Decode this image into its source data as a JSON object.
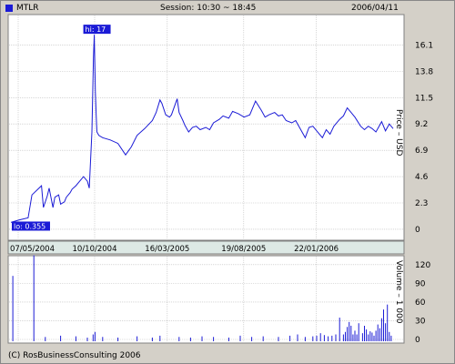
{
  "header": {
    "ticker": "MTLR",
    "session": "Session: 10:30 ~ 18:45",
    "date": "2006/04/11"
  },
  "footer": {
    "copyright": "(C) RosBusinessConsulting 2006"
  },
  "colors": {
    "frame_bg": "#d4d0c8",
    "plot_bg": "#ffffff",
    "line": "#1b1bd6",
    "bars": "#1b1bd6",
    "grid": "#bdbdbd",
    "date_bar": "#dde9e5",
    "marker_bg": "#1b1bd6",
    "marker_text": "#ffffff"
  },
  "chart_data": [
    {
      "type": "line",
      "title": "",
      "ylabel": "Price – USD",
      "xlabel": "",
      "yticks": [
        "0",
        "2.3",
        "4.6",
        "6.9",
        "9.2",
        "11.5",
        "13.8",
        "16.1"
      ],
      "ytick_values": [
        0,
        2.3,
        4.6,
        6.9,
        9.2,
        11.5,
        13.8,
        16.1
      ],
      "ylim": [
        -0.8,
        18.6
      ],
      "x_tick_labels": [
        "07/05/2004",
        "10/10/2004",
        "16/03/2005",
        "19/08/2005",
        "22/01/2006"
      ],
      "x_tick_positions": [
        0,
        0.2,
        0.39,
        0.59,
        0.78
      ],
      "grid": true,
      "markers": {
        "high": {
          "label": "hi: 17",
          "value": 17
        },
        "low": {
          "label": "lo: 0.355",
          "value": 0.355
        }
      },
      "series": [
        {
          "x": [
            0,
            0.02,
            0.045,
            0.055,
            0.08,
            0.085,
            0.095,
            0.1,
            0.11,
            0.115,
            0.125,
            0.13,
            0.14,
            0.145,
            0.155,
            0.16,
            0.17,
            0.18,
            0.19,
            0.2,
            0.205,
            0.212,
            0.216,
            0.218,
            0.221,
            0.223,
            0.225,
            0.23,
            0.24,
            0.26,
            0.28,
            0.3,
            0.315,
            0.33,
            0.35,
            0.37,
            0.38,
            0.39,
            0.395,
            0.405,
            0.415,
            0.42,
            0.435,
            0.44,
            0.45,
            0.455,
            0.465,
            0.475,
            0.485,
            0.495,
            0.51,
            0.52,
            0.53,
            0.545,
            0.555,
            0.57,
            0.58,
            0.595,
            0.61,
            0.625,
            0.64,
            0.655,
            0.665,
            0.675,
            0.69,
            0.7,
            0.71,
            0.72,
            0.735,
            0.745,
            0.76,
            0.77,
            0.78,
            0.79,
            0.8,
            0.815,
            0.825,
            0.835,
            0.845,
            0.86,
            0.87,
            0.88,
            0.89,
            0.9,
            0.915,
            0.925,
            0.935,
            0.945,
            0.955,
            0.97,
            0.98,
            0.99,
            1.0
          ],
          "values": [
            0.6,
            0.8,
            1.0,
            3.0,
            3.8,
            1.9,
            2.9,
            3.6,
            1.9,
            2.8,
            3.0,
            2.2,
            2.4,
            2.8,
            3.2,
            3.5,
            3.8,
            4.2,
            4.6,
            4.2,
            3.6,
            8.5,
            15.0,
            17.0,
            12.0,
            10.0,
            8.5,
            8.2,
            8.0,
            7.8,
            7.5,
            6.5,
            7.2,
            8.2,
            8.8,
            9.5,
            10.2,
            11.3,
            11.0,
            10.0,
            9.8,
            10.0,
            11.4,
            10.2,
            9.5,
            9.1,
            8.5,
            8.9,
            9.0,
            8.7,
            8.9,
            8.7,
            9.3,
            9.6,
            9.9,
            9.7,
            10.3,
            10.1,
            9.8,
            10.0,
            11.2,
            10.4,
            9.8,
            10.0,
            10.2,
            9.9,
            10.0,
            9.5,
            9.3,
            9.5,
            8.6,
            8.0,
            8.9,
            9.0,
            8.6,
            8.0,
            8.7,
            8.3,
            9.0,
            9.6,
            9.9,
            10.6,
            10.2,
            9.8,
            9.0,
            8.7,
            9.0,
            8.8,
            8.5,
            9.4,
            8.6,
            9.2,
            8.8
          ]
        }
      ]
    },
    {
      "type": "bar",
      "title": "",
      "ylabel": "Volume – 1 000",
      "yticks": [
        "0",
        "30",
        "60",
        "90",
        "120"
      ],
      "ytick_values": [
        0,
        30,
        60,
        90,
        120
      ],
      "ylim": [
        0,
        130
      ],
      "grid": true,
      "x": [
        0.005,
        0.06,
        0.09,
        0.13,
        0.17,
        0.2,
        0.215,
        0.22,
        0.24,
        0.28,
        0.33,
        0.37,
        0.39,
        0.44,
        0.47,
        0.5,
        0.53,
        0.57,
        0.6,
        0.63,
        0.66,
        0.7,
        0.73,
        0.75,
        0.77,
        0.79,
        0.8,
        0.81,
        0.82,
        0.83,
        0.84,
        0.85,
        0.86,
        0.87,
        0.875,
        0.88,
        0.885,
        0.89,
        0.895,
        0.9,
        0.905,
        0.91,
        0.92,
        0.925,
        0.93,
        0.935,
        0.94,
        0.945,
        0.95,
        0.955,
        0.96,
        0.965,
        0.97,
        0.975,
        0.98,
        0.985,
        0.99,
        0.995
      ],
      "values": [
        102,
        135,
        4,
        6,
        5,
        3,
        8,
        12,
        4,
        3,
        5,
        3,
        6,
        4,
        3,
        5,
        4,
        3,
        6,
        4,
        5,
        4,
        6,
        8,
        4,
        5,
        6,
        10,
        7,
        5,
        6,
        8,
        35,
        8,
        12,
        20,
        28,
        22,
        8,
        14,
        8,
        26,
        10,
        22,
        16,
        8,
        13,
        11,
        6,
        14,
        24,
        18,
        34,
        48,
        26,
        56,
        12,
        6
      ]
    }
  ]
}
